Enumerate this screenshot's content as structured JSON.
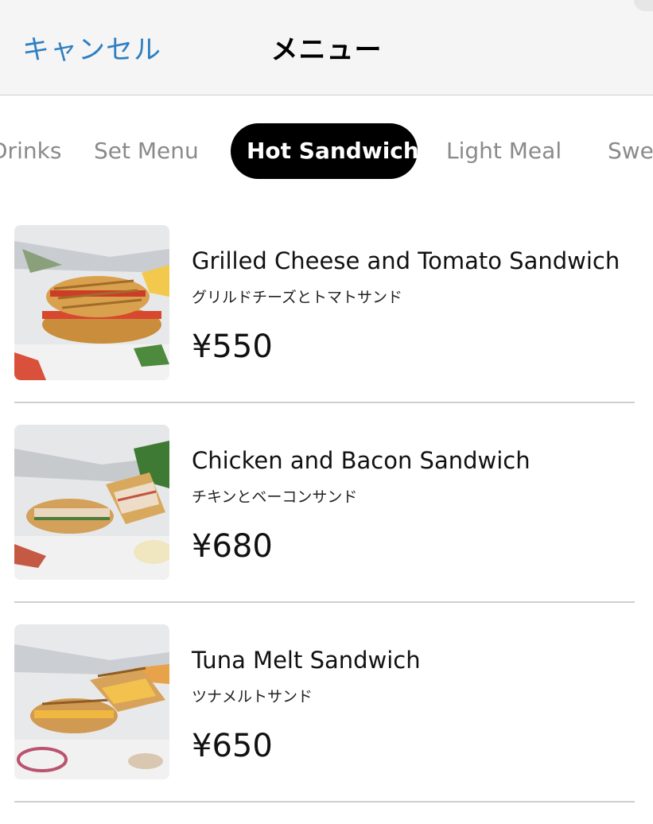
{
  "nav": {
    "cancel_label": "キャンセル",
    "title": "メニュー"
  },
  "categories": [
    {
      "label": "Drinks",
      "active": false
    },
    {
      "label": "Set Menu",
      "active": false
    },
    {
      "label": "Hot Sandwich",
      "active": true
    },
    {
      "label": "Light Meal",
      "active": false
    },
    {
      "label": "Sweets",
      "active": false
    }
  ],
  "items": [
    {
      "name": "Grilled Cheese and Tomato Sandwich",
      "subtitle": "グリルドチーズとトマトサンド",
      "price": "¥550"
    },
    {
      "name": "Chicken and Bacon Sandwich",
      "subtitle": "チキンとベーコンサンド",
      "price": "¥680"
    },
    {
      "name": "Tuna Melt Sandwich",
      "subtitle": "ツナメルトサンド",
      "price": "¥650"
    }
  ],
  "colors": {
    "accent": "#2f7fc1",
    "active_tab_bg": "#000000",
    "inactive_tab_text": "#8a8a8a",
    "nav_bg": "#f5f5f5"
  }
}
